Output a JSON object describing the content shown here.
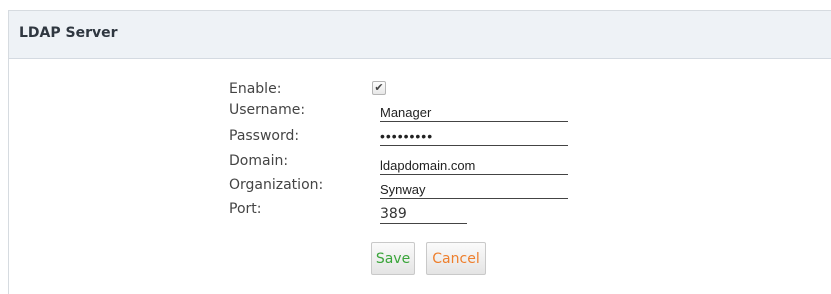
{
  "panel": {
    "title": "LDAP Server"
  },
  "form": {
    "enable": {
      "label": "Enable:",
      "checked": true,
      "check_glyph": "✔"
    },
    "username": {
      "label": "Username:",
      "value": "Manager"
    },
    "password": {
      "label": "Password:",
      "value": "•••••••••"
    },
    "domain": {
      "label": "Domain:",
      "value": "ldapdomain.com"
    },
    "organization": {
      "label": "Organization:",
      "value": "Synway"
    },
    "port": {
      "label": "Port:",
      "value": "389"
    }
  },
  "buttons": {
    "save": "Save",
    "cancel": "Cancel"
  },
  "colors": {
    "header_bg": "#eef2f6",
    "save_text": "#3aa53a",
    "cancel_text": "#ee7f2d"
  }
}
